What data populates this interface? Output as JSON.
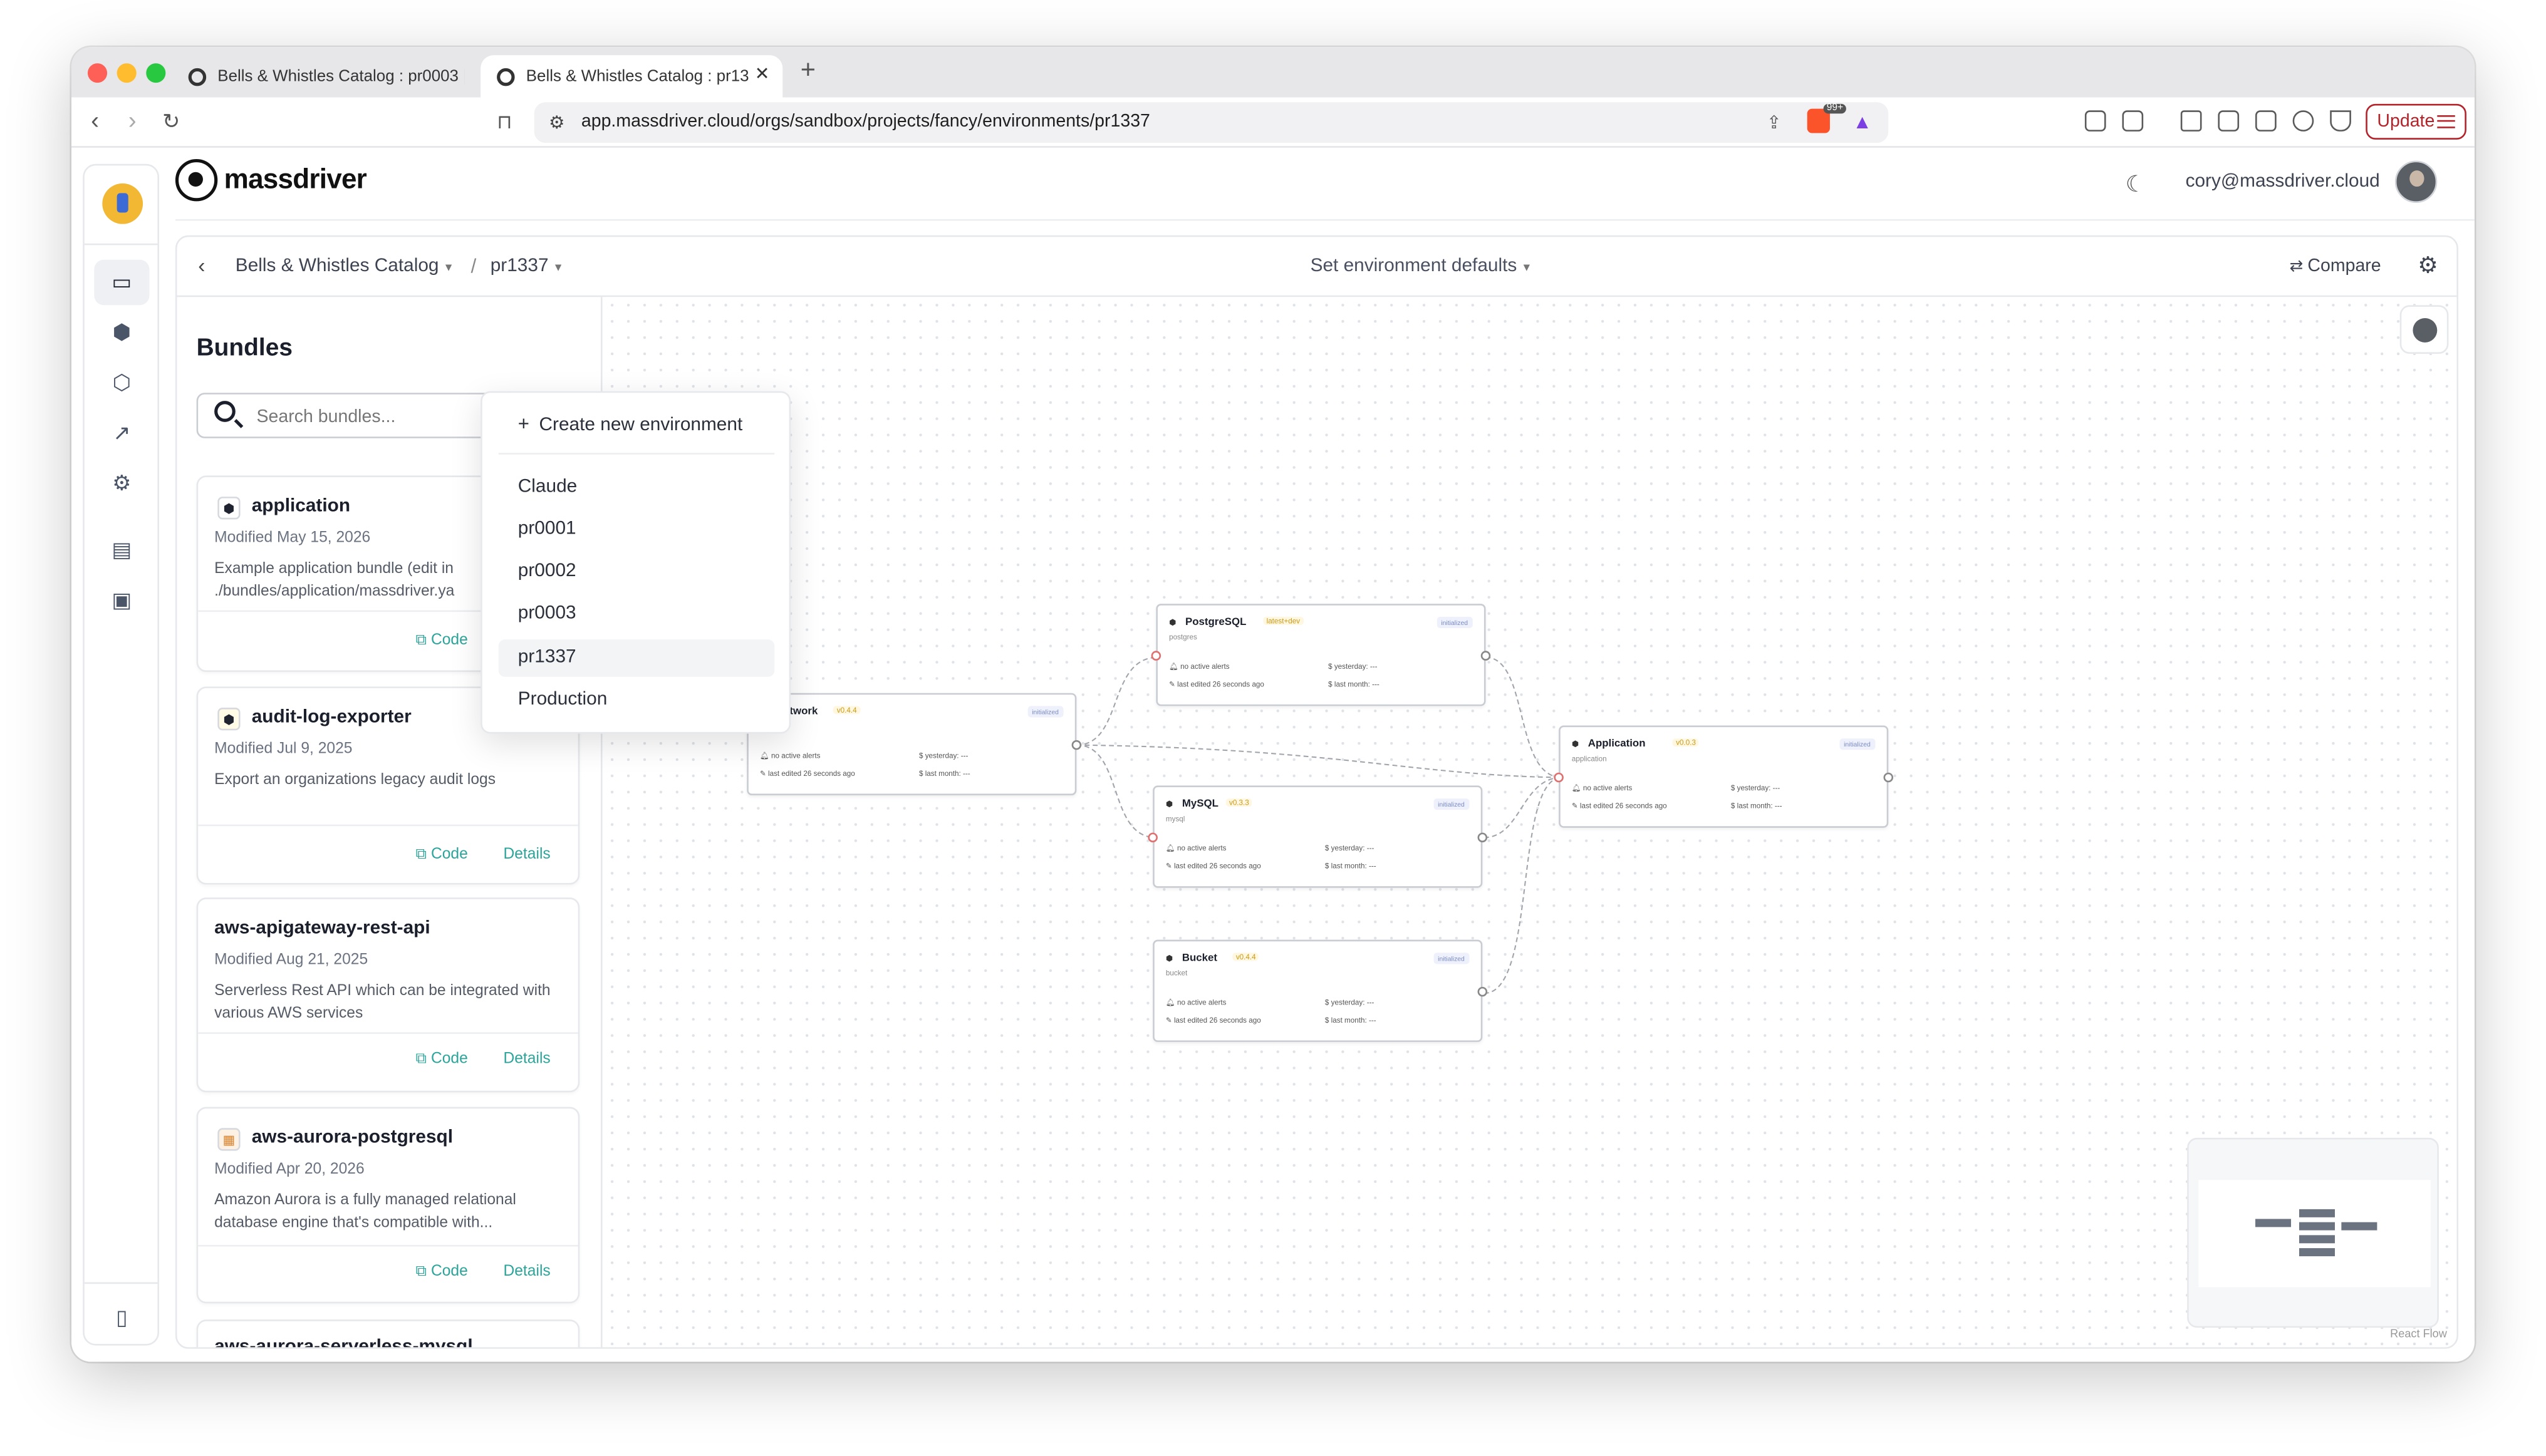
{
  "browser": {
    "tabs": [
      {
        "label": "Bells & Whistles Catalog : pr0003 |"
      },
      {
        "label": "Bells & Whistles Catalog : pr13"
      }
    ],
    "new_tab": "+",
    "close_tab": "✕",
    "url": "app.massdriver.cloud/orgs/sandbox/projects/fancy/environments/pr1337",
    "update_label": "Update",
    "brave_badge": "99+"
  },
  "app": {
    "logo_text": "massdriver",
    "user_email": "cory@massdriver.cloud"
  },
  "breadcrumb": {
    "project": "Bells & Whistles Catalog",
    "separator": "/",
    "environment": "pr1337",
    "center_action": "Set environment defaults",
    "compare": "Compare"
  },
  "sidebar": {
    "title": "Bundles",
    "search_placeholder": "Search bundles...",
    "code_label": "Code",
    "details_label": "Details",
    "bundles": [
      {
        "name": "application",
        "modified": "Modified May 15, 2026",
        "description": "Example application bundle (edit in ./bundles/application/massdriver.ya"
      },
      {
        "name": "audit-log-exporter",
        "modified": "Modified Jul 9, 2025",
        "description": "Export an organizations legacy audit logs"
      },
      {
        "name": "aws-apigateway-rest-api",
        "modified": "Modified Aug 21, 2025",
        "description": "Serverless Rest API which can be integrated with various AWS services"
      },
      {
        "name": "aws-aurora-postgresql",
        "modified": "Modified Apr 20, 2026",
        "description": "Amazon Aurora is a fully managed relational database engine that's compatible with..."
      },
      {
        "name": "aws-aurora-serverless-mysql",
        "modified": "",
        "description": ""
      }
    ]
  },
  "env_dropdown": {
    "create": "Create new environment",
    "options": [
      "Claude",
      "pr0001",
      "pr0002",
      "pr0003",
      "pr1337",
      "Production"
    ],
    "selected": "pr1337"
  },
  "canvas": {
    "nodes": [
      {
        "id": "network",
        "name": "Network",
        "version": "v0.4.4",
        "sub": "network",
        "status": "initialized",
        "alerts": "no active alerts",
        "edited": "last edited 26 seconds ago",
        "yesterday": "yesterday: ---",
        "month": "last month: ---"
      },
      {
        "id": "postgresql",
        "name": "PostgreSQL",
        "version": "latest+dev",
        "sub": "postgres",
        "status": "initialized",
        "alerts": "no active alerts",
        "edited": "last edited 26 seconds ago",
        "yesterday": "yesterday: ---",
        "month": "last month: ---"
      },
      {
        "id": "mysql",
        "name": "MySQL",
        "version": "v0.3.3",
        "sub": "mysql",
        "status": "initialized",
        "alerts": "no active alerts",
        "edited": "last edited 26 seconds ago",
        "yesterday": "yesterday: ---",
        "month": "last month: ---"
      },
      {
        "id": "bucket",
        "name": "Bucket",
        "version": "v0.4.4",
        "sub": "bucket",
        "status": "initialized",
        "alerts": "no active alerts",
        "edited": "last edited 26 seconds ago",
        "yesterday": "yesterday: ---",
        "month": "last month: ---"
      },
      {
        "id": "application",
        "name": "Application",
        "version": "v0.0.3",
        "sub": "application",
        "status": "initialized",
        "alerts": "no active alerts",
        "edited": "last edited 26 seconds ago",
        "yesterday": "yesterday: ---",
        "month": "last month: ---"
      }
    ],
    "attribution": "React Flow"
  },
  "icons": {
    "back": "chevron-left-icon",
    "forward": "chevron-right-icon",
    "reload": "reload-icon",
    "bookmark": "bookmark-icon",
    "search": "search-icon",
    "moon": "moon-icon",
    "gear": "gear-icon"
  },
  "colors": {
    "accent": "#2ba59a",
    "update": "#b4232a",
    "version_tag": "#c99a1a"
  }
}
